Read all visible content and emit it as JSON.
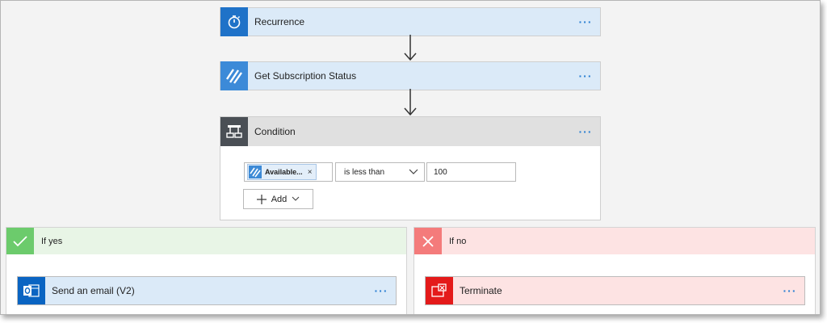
{
  "steps": [
    {
      "title": "Recurrence",
      "more": "···",
      "icon": "stopwatch-icon"
    },
    {
      "title": "Get Subscription Status",
      "more": "···",
      "icon": "stripes-connector-icon"
    }
  ],
  "condition": {
    "title": "Condition",
    "more": "···",
    "icon": "condition-icon",
    "token_label": "Available...",
    "token_remove": "×",
    "operator": "is less than",
    "value": "100",
    "add_label": "Add"
  },
  "branches": {
    "yes": {
      "label": "If yes",
      "action_title": "Send an email (V2)",
      "action_more": "···",
      "header_color": "#e8f5e6",
      "accent": "#6ccb6c"
    },
    "no": {
      "label": "If no",
      "action_title": "Terminate",
      "action_more": "···",
      "header_color": "#fde3e3",
      "accent": "#f47b7b"
    }
  },
  "colors": {
    "step_header": "#dbeaf8",
    "step_icon_bg": "#1f72c8",
    "connector_icon_bg": "#3c8ad8",
    "condition_header": "#e0e0e0",
    "condition_icon_bg": "#4a4f55",
    "outlook_bg": "#0a64c2",
    "terminate_bg": "#e41a1a"
  }
}
